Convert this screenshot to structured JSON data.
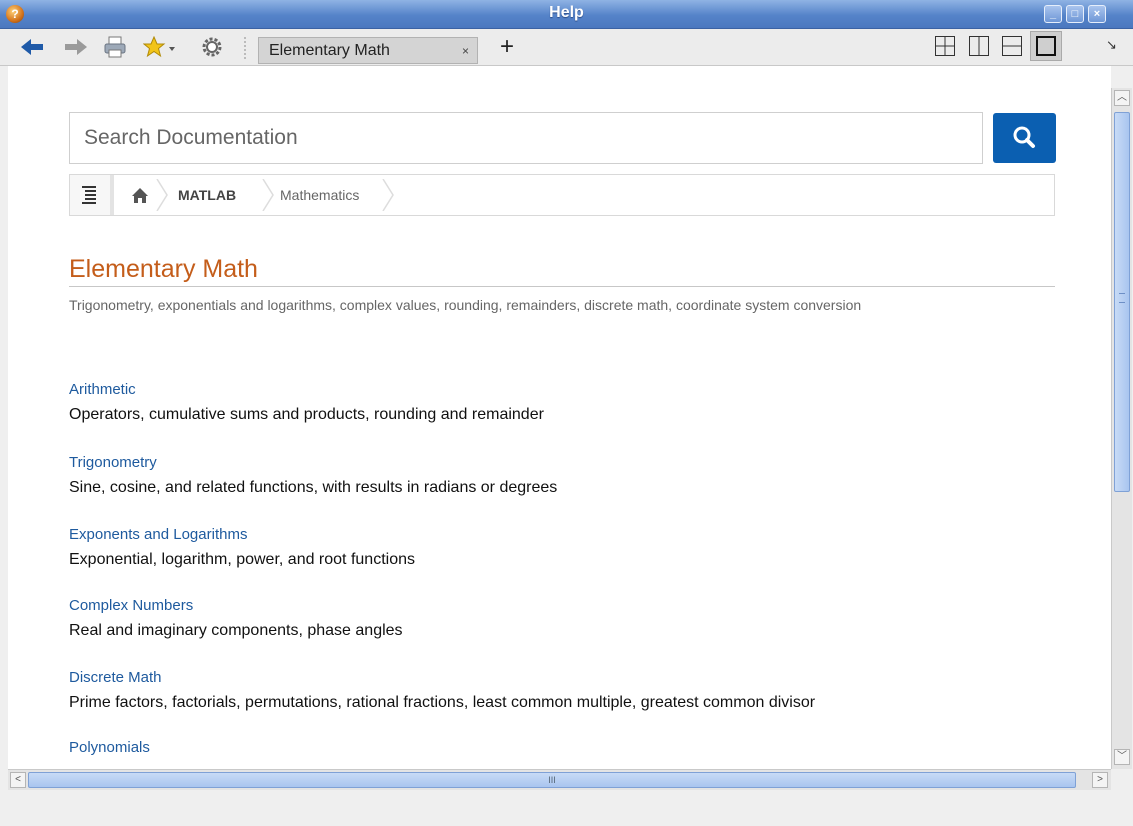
{
  "window": {
    "title": "Help"
  },
  "toolbar": {
    "tab_label": "Elementary Math",
    "tab_close": "×",
    "new_tab": "+"
  },
  "search": {
    "placeholder": "Search Documentation"
  },
  "breadcrumb": {
    "items": [
      "MATLAB",
      "Mathematics"
    ]
  },
  "page": {
    "title": "Elementary Math",
    "subtitle": "Trigonometry, exponentials and logarithms, complex values, rounding, remainders, discrete math, coordinate system conversion"
  },
  "topics": [
    {
      "label": "Arithmetic",
      "description": "Operators, cumulative sums and products, rounding and remainder"
    },
    {
      "label": "Trigonometry",
      "description": "Sine, cosine, and related functions, with results in radians or degrees"
    },
    {
      "label": "Exponents and Logarithms",
      "description": "Exponential, logarithm, power, and root functions"
    },
    {
      "label": "Complex Numbers",
      "description": "Real and imaginary components, phase angles"
    },
    {
      "label": "Discrete Math",
      "description": "Prime factors, factorials, permutations, rational fractions, least common multiple, greatest common divisor"
    },
    {
      "label": "Polynomials",
      "description": ""
    }
  ],
  "scroll": {
    "grip": "III"
  },
  "colors": {
    "accent": "#c45d1a",
    "link": "#1e5a9e",
    "search_button": "#0b5fb1",
    "titlebar": "#5583c9"
  },
  "icons": [
    "help-app-icon",
    "back-arrow-icon",
    "forward-arrow-icon",
    "print-icon",
    "favorites-star-icon",
    "gear-icon",
    "search-icon",
    "table-of-contents-icon",
    "home-icon"
  ]
}
